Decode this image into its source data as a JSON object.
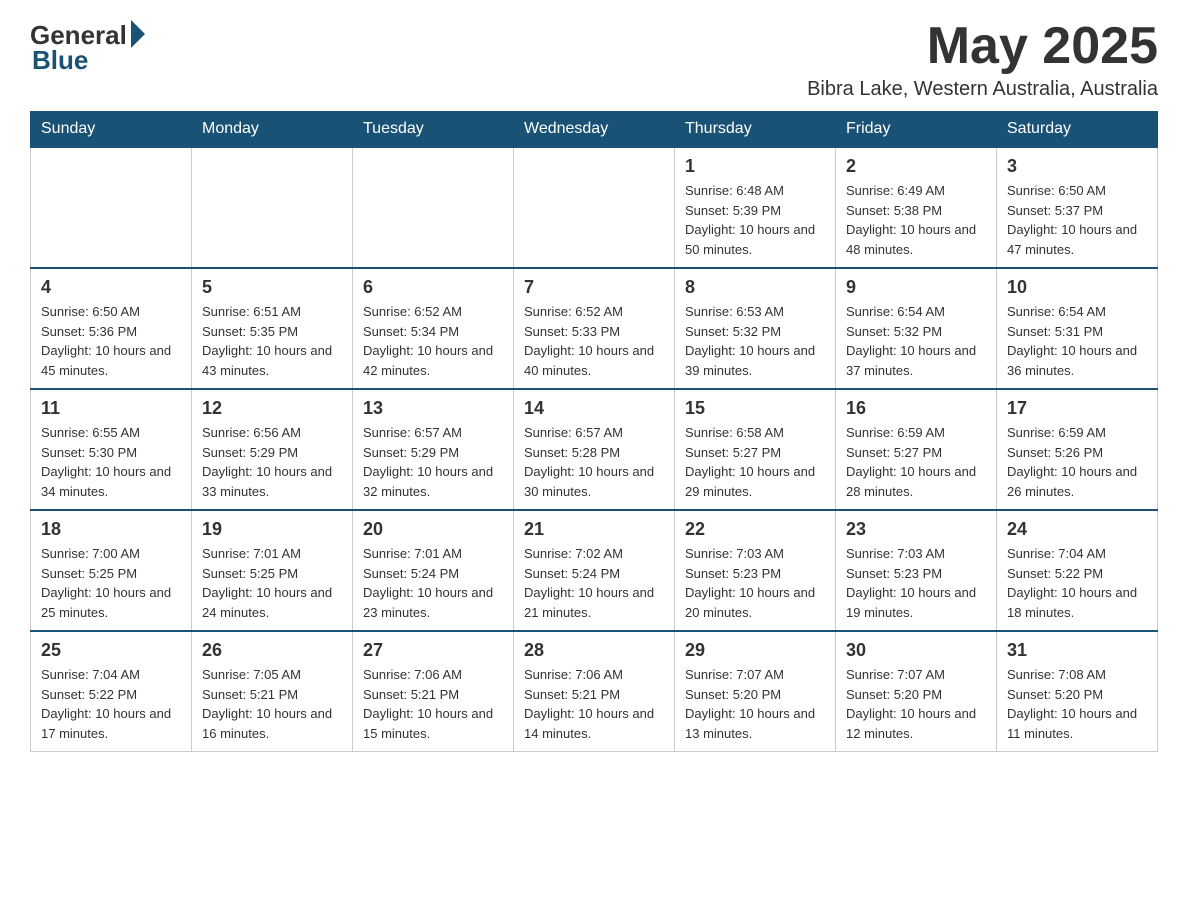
{
  "logo": {
    "general": "General",
    "blue": "Blue"
  },
  "header": {
    "month_year": "May 2025",
    "location": "Bibra Lake, Western Australia, Australia"
  },
  "days_of_week": [
    "Sunday",
    "Monday",
    "Tuesday",
    "Wednesday",
    "Thursday",
    "Friday",
    "Saturday"
  ],
  "weeks": [
    [
      {
        "day": "",
        "sunrise": "",
        "sunset": "",
        "daylight": ""
      },
      {
        "day": "",
        "sunrise": "",
        "sunset": "",
        "daylight": ""
      },
      {
        "day": "",
        "sunrise": "",
        "sunset": "",
        "daylight": ""
      },
      {
        "day": "",
        "sunrise": "",
        "sunset": "",
        "daylight": ""
      },
      {
        "day": "1",
        "sunrise": "Sunrise: 6:48 AM",
        "sunset": "Sunset: 5:39 PM",
        "daylight": "Daylight: 10 hours and 50 minutes."
      },
      {
        "day": "2",
        "sunrise": "Sunrise: 6:49 AM",
        "sunset": "Sunset: 5:38 PM",
        "daylight": "Daylight: 10 hours and 48 minutes."
      },
      {
        "day": "3",
        "sunrise": "Sunrise: 6:50 AM",
        "sunset": "Sunset: 5:37 PM",
        "daylight": "Daylight: 10 hours and 47 minutes."
      }
    ],
    [
      {
        "day": "4",
        "sunrise": "Sunrise: 6:50 AM",
        "sunset": "Sunset: 5:36 PM",
        "daylight": "Daylight: 10 hours and 45 minutes."
      },
      {
        "day": "5",
        "sunrise": "Sunrise: 6:51 AM",
        "sunset": "Sunset: 5:35 PM",
        "daylight": "Daylight: 10 hours and 43 minutes."
      },
      {
        "day": "6",
        "sunrise": "Sunrise: 6:52 AM",
        "sunset": "Sunset: 5:34 PM",
        "daylight": "Daylight: 10 hours and 42 minutes."
      },
      {
        "day": "7",
        "sunrise": "Sunrise: 6:52 AM",
        "sunset": "Sunset: 5:33 PM",
        "daylight": "Daylight: 10 hours and 40 minutes."
      },
      {
        "day": "8",
        "sunrise": "Sunrise: 6:53 AM",
        "sunset": "Sunset: 5:32 PM",
        "daylight": "Daylight: 10 hours and 39 minutes."
      },
      {
        "day": "9",
        "sunrise": "Sunrise: 6:54 AM",
        "sunset": "Sunset: 5:32 PM",
        "daylight": "Daylight: 10 hours and 37 minutes."
      },
      {
        "day": "10",
        "sunrise": "Sunrise: 6:54 AM",
        "sunset": "Sunset: 5:31 PM",
        "daylight": "Daylight: 10 hours and 36 minutes."
      }
    ],
    [
      {
        "day": "11",
        "sunrise": "Sunrise: 6:55 AM",
        "sunset": "Sunset: 5:30 PM",
        "daylight": "Daylight: 10 hours and 34 minutes."
      },
      {
        "day": "12",
        "sunrise": "Sunrise: 6:56 AM",
        "sunset": "Sunset: 5:29 PM",
        "daylight": "Daylight: 10 hours and 33 minutes."
      },
      {
        "day": "13",
        "sunrise": "Sunrise: 6:57 AM",
        "sunset": "Sunset: 5:29 PM",
        "daylight": "Daylight: 10 hours and 32 minutes."
      },
      {
        "day": "14",
        "sunrise": "Sunrise: 6:57 AM",
        "sunset": "Sunset: 5:28 PM",
        "daylight": "Daylight: 10 hours and 30 minutes."
      },
      {
        "day": "15",
        "sunrise": "Sunrise: 6:58 AM",
        "sunset": "Sunset: 5:27 PM",
        "daylight": "Daylight: 10 hours and 29 minutes."
      },
      {
        "day": "16",
        "sunrise": "Sunrise: 6:59 AM",
        "sunset": "Sunset: 5:27 PM",
        "daylight": "Daylight: 10 hours and 28 minutes."
      },
      {
        "day": "17",
        "sunrise": "Sunrise: 6:59 AM",
        "sunset": "Sunset: 5:26 PM",
        "daylight": "Daylight: 10 hours and 26 minutes."
      }
    ],
    [
      {
        "day": "18",
        "sunrise": "Sunrise: 7:00 AM",
        "sunset": "Sunset: 5:25 PM",
        "daylight": "Daylight: 10 hours and 25 minutes."
      },
      {
        "day": "19",
        "sunrise": "Sunrise: 7:01 AM",
        "sunset": "Sunset: 5:25 PM",
        "daylight": "Daylight: 10 hours and 24 minutes."
      },
      {
        "day": "20",
        "sunrise": "Sunrise: 7:01 AM",
        "sunset": "Sunset: 5:24 PM",
        "daylight": "Daylight: 10 hours and 23 minutes."
      },
      {
        "day": "21",
        "sunrise": "Sunrise: 7:02 AM",
        "sunset": "Sunset: 5:24 PM",
        "daylight": "Daylight: 10 hours and 21 minutes."
      },
      {
        "day": "22",
        "sunrise": "Sunrise: 7:03 AM",
        "sunset": "Sunset: 5:23 PM",
        "daylight": "Daylight: 10 hours and 20 minutes."
      },
      {
        "day": "23",
        "sunrise": "Sunrise: 7:03 AM",
        "sunset": "Sunset: 5:23 PM",
        "daylight": "Daylight: 10 hours and 19 minutes."
      },
      {
        "day": "24",
        "sunrise": "Sunrise: 7:04 AM",
        "sunset": "Sunset: 5:22 PM",
        "daylight": "Daylight: 10 hours and 18 minutes."
      }
    ],
    [
      {
        "day": "25",
        "sunrise": "Sunrise: 7:04 AM",
        "sunset": "Sunset: 5:22 PM",
        "daylight": "Daylight: 10 hours and 17 minutes."
      },
      {
        "day": "26",
        "sunrise": "Sunrise: 7:05 AM",
        "sunset": "Sunset: 5:21 PM",
        "daylight": "Daylight: 10 hours and 16 minutes."
      },
      {
        "day": "27",
        "sunrise": "Sunrise: 7:06 AM",
        "sunset": "Sunset: 5:21 PM",
        "daylight": "Daylight: 10 hours and 15 minutes."
      },
      {
        "day": "28",
        "sunrise": "Sunrise: 7:06 AM",
        "sunset": "Sunset: 5:21 PM",
        "daylight": "Daylight: 10 hours and 14 minutes."
      },
      {
        "day": "29",
        "sunrise": "Sunrise: 7:07 AM",
        "sunset": "Sunset: 5:20 PM",
        "daylight": "Daylight: 10 hours and 13 minutes."
      },
      {
        "day": "30",
        "sunrise": "Sunrise: 7:07 AM",
        "sunset": "Sunset: 5:20 PM",
        "daylight": "Daylight: 10 hours and 12 minutes."
      },
      {
        "day": "31",
        "sunrise": "Sunrise: 7:08 AM",
        "sunset": "Sunset: 5:20 PM",
        "daylight": "Daylight: 10 hours and 11 minutes."
      }
    ]
  ]
}
